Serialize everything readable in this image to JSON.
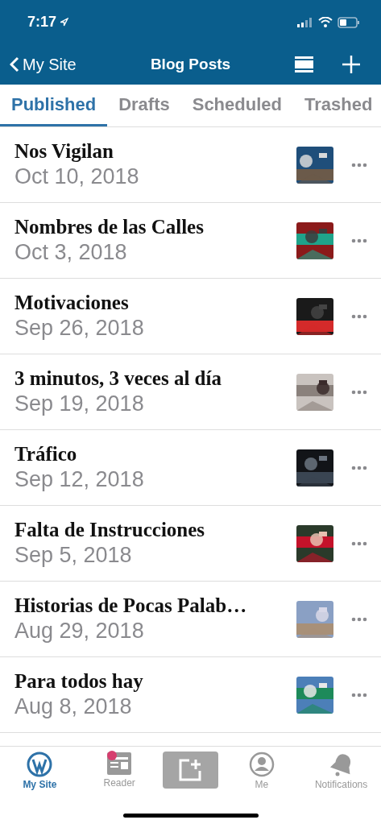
{
  "status_bar": {
    "time": "7:17"
  },
  "nav_bar": {
    "back": "My Site",
    "title": "Blog Posts"
  },
  "tabs": [
    {
      "label": "Published",
      "selected": true
    },
    {
      "label": "Drafts",
      "selected": false
    },
    {
      "label": "Scheduled",
      "selected": false
    },
    {
      "label": "Trashed",
      "selected": false
    }
  ],
  "posts": [
    {
      "title": "Nos Vigilan",
      "date": "Oct 10, 2018"
    },
    {
      "title": "Nombres de las Calles",
      "date": "Oct 3, 2018"
    },
    {
      "title": "Motivaciones",
      "date": "Sep 26, 2018"
    },
    {
      "title": "3 minutos, 3 veces al día",
      "date": "Sep 19, 2018"
    },
    {
      "title": "Tráfico",
      "date": "Sep 12, 2018"
    },
    {
      "title": "Falta de Instrucciones",
      "date": "Sep 5, 2018"
    },
    {
      "title": "Historias de Pocas Palab…",
      "date": "Aug 29, 2018"
    },
    {
      "title": "Para todos hay",
      "date": "Aug 8, 2018"
    }
  ],
  "tab_bar": [
    {
      "kind": "site",
      "label": "My Site",
      "selected": true,
      "badge": false
    },
    {
      "kind": "reader",
      "label": "Reader",
      "selected": false,
      "badge": true
    },
    {
      "kind": "write"
    },
    {
      "kind": "me",
      "label": "Me",
      "selected": false,
      "badge": false
    },
    {
      "kind": "notifications",
      "label": "Notifications",
      "selected": false,
      "badge": false
    }
  ]
}
